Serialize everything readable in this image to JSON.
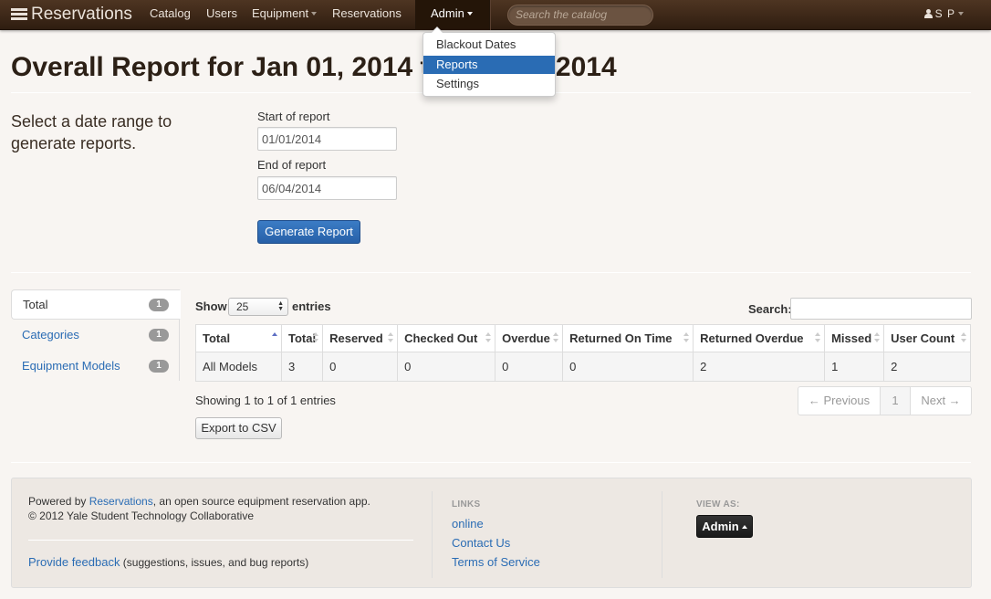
{
  "navbar": {
    "brand": "Reservations",
    "items": [
      "Catalog",
      "Users",
      "Equipment",
      "Reservations"
    ],
    "admin_label": "Admin",
    "search_placeholder": "Search the catalog",
    "user_initials": "S P"
  },
  "admin_menu": {
    "items": [
      "Blackout Dates",
      "Reports",
      "Settings"
    ],
    "active": "Reports"
  },
  "page": {
    "title": "Overall Report for Jan 01, 2014 to Jun 04, 2014"
  },
  "form": {
    "intro": "Select a date range to generate reports.",
    "start_label": "Start of report",
    "start_value": "01/01/2014",
    "end_label": "End of report",
    "end_value": "06/04/2014",
    "submit_label": "Generate Report"
  },
  "tabs": [
    {
      "label": "Total",
      "count": "1"
    },
    {
      "label": "Categories",
      "count": "1"
    },
    {
      "label": "Equipment Models",
      "count": "1"
    }
  ],
  "table": {
    "show_label": "Show",
    "entries_value": "25",
    "entries_label": "entries",
    "search_label": "Search:",
    "columns": [
      "Total",
      "Total",
      "Reserved",
      "Checked Out",
      "Overdue",
      "Returned On Time",
      "Returned Overdue",
      "Missed",
      "User Count"
    ],
    "rows": [
      [
        "All Models",
        "3",
        "0",
        "0",
        "0",
        "0",
        "2",
        "1",
        "2"
      ]
    ],
    "info": "Showing 1 to 1 of 1 entries",
    "pager": {
      "prev": "← Previous",
      "page": "1",
      "next": "Next →"
    },
    "export_label": "Export to CSV"
  },
  "footer": {
    "powered_prefix": "Powered by ",
    "powered_link": "Reservations",
    "powered_suffix": ", an open source equipment reservation app.",
    "copyright": "© 2012 Yale Student Technology Collaborative",
    "feedback_link": "Provide feedback",
    "feedback_suffix": " (suggestions, issues, and bug reports)",
    "links_heading": "LINKS",
    "links": [
      "online",
      "Contact Us",
      "Terms of Service"
    ],
    "view_as_heading": "VIEW AS:",
    "view_as_value": "Admin"
  },
  "colors": {
    "navbar": "#3e2817",
    "accent": "#2a6cb4",
    "background": "#f8f5f2"
  }
}
